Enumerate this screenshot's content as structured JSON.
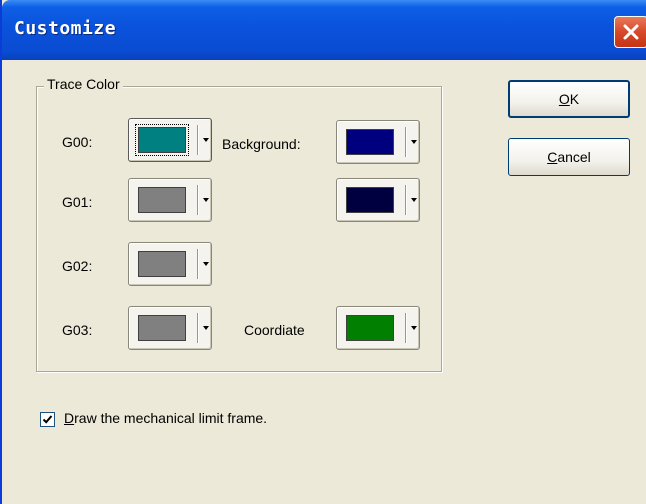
{
  "window": {
    "title": "Customize"
  },
  "colors": {
    "titlebar": "#0a52dc",
    "dialog_bg": "#ece9d8",
    "g00": "#008080",
    "g01": "#808080",
    "g02": "#808080",
    "g03": "#808080",
    "background": "#00007f",
    "background2": "#000040",
    "coordinate": "#007f00"
  },
  "trace_color": {
    "legend": "Trace Color",
    "g00_label": "G00:",
    "g01_label": "G01:",
    "g02_label": "G02:",
    "g03_label": "G03:",
    "background_label": "Background:",
    "coordinate_label": "Coordiate"
  },
  "buttons": {
    "ok_mnemonic": "O",
    "ok_rest": "K",
    "cancel_mnemonic": "C",
    "cancel_rest": "ancel"
  },
  "options": {
    "draw_limit_checked": true,
    "draw_limit_mnemonic": "D",
    "draw_limit_rest": "raw the mechanical limit frame."
  },
  "icons": {
    "close": "close-icon",
    "dropdown": "chevron-down-icon",
    "check": "checkmark-icon"
  }
}
